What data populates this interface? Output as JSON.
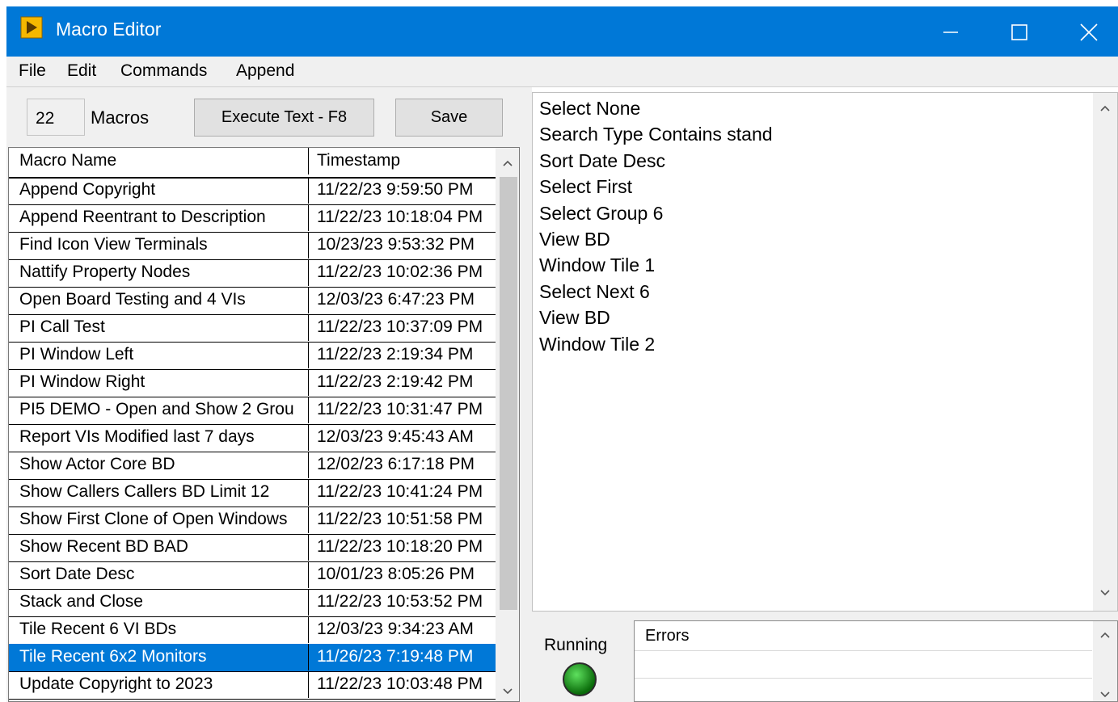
{
  "window": {
    "title": "Macro Editor"
  },
  "menu": [
    "File",
    "Edit",
    "Commands",
    "Append"
  ],
  "toolbar": {
    "count": "22",
    "count_label": "Macros",
    "execute_label": "Execute Text - F8",
    "save_label": "Save"
  },
  "table": {
    "headers": [
      "Macro Name",
      "Timestamp"
    ],
    "rows": [
      {
        "name": "Append Copyright",
        "ts": "11/22/23 9:59:50 PM"
      },
      {
        "name": "Append Reentrant to Description",
        "ts": "11/22/23 10:18:04 PM"
      },
      {
        "name": "Find Icon View Terminals",
        "ts": "10/23/23 9:53:32 PM"
      },
      {
        "name": "Nattify Property Nodes",
        "ts": "11/22/23 10:02:36 PM"
      },
      {
        "name": "Open Board Testing and 4 VIs",
        "ts": "12/03/23 6:47:23 PM"
      },
      {
        "name": "PI Call Test",
        "ts": "11/22/23 10:37:09 PM"
      },
      {
        "name": "PI Window Left",
        "ts": "11/22/23 2:19:34 PM"
      },
      {
        "name": "PI Window Right",
        "ts": "11/22/23 2:19:42 PM"
      },
      {
        "name": "PI5 DEMO - Open and Show 2 Grou",
        "ts": "11/22/23 10:31:47 PM"
      },
      {
        "name": "Report VIs Modified last 7 days",
        "ts": "12/03/23 9:45:43 AM"
      },
      {
        "name": "Show Actor Core BD",
        "ts": "12/02/23 6:17:18 PM"
      },
      {
        "name": "Show Callers Callers BD Limit 12",
        "ts": "11/22/23 10:41:24 PM"
      },
      {
        "name": "Show First Clone of Open Windows",
        "ts": "11/22/23 10:51:58 PM"
      },
      {
        "name": "Show Recent BD BAD",
        "ts": "11/22/23 10:18:20 PM"
      },
      {
        "name": "Sort Date Desc",
        "ts": "10/01/23 8:05:26 PM"
      },
      {
        "name": "Stack and Close",
        "ts": "11/22/23 10:53:52 PM"
      },
      {
        "name": "Tile Recent 6 VI BDs",
        "ts": "12/03/23 9:34:23 AM"
      },
      {
        "name": "Tile Recent 6x2 Monitors",
        "ts": "11/26/23 7:19:48 PM"
      },
      {
        "name": "Update Copyright to 2023",
        "ts": "11/22/23 10:03:48 PM"
      }
    ],
    "selected_index": 17
  },
  "macro_text": [
    "Select None",
    "Search Type Contains stand",
    "Sort Date Desc",
    "Select First",
    "Select Group 6",
    "View BD",
    "Window Tile 1",
    "Select Next 6",
    "View BD",
    "Window Tile 2"
  ],
  "status": {
    "running_label": "Running",
    "running_color": "#1a8a1a",
    "errors_label": "Errors"
  },
  "colors": {
    "titlebar": "#0078d7",
    "selection": "#0078d7"
  }
}
